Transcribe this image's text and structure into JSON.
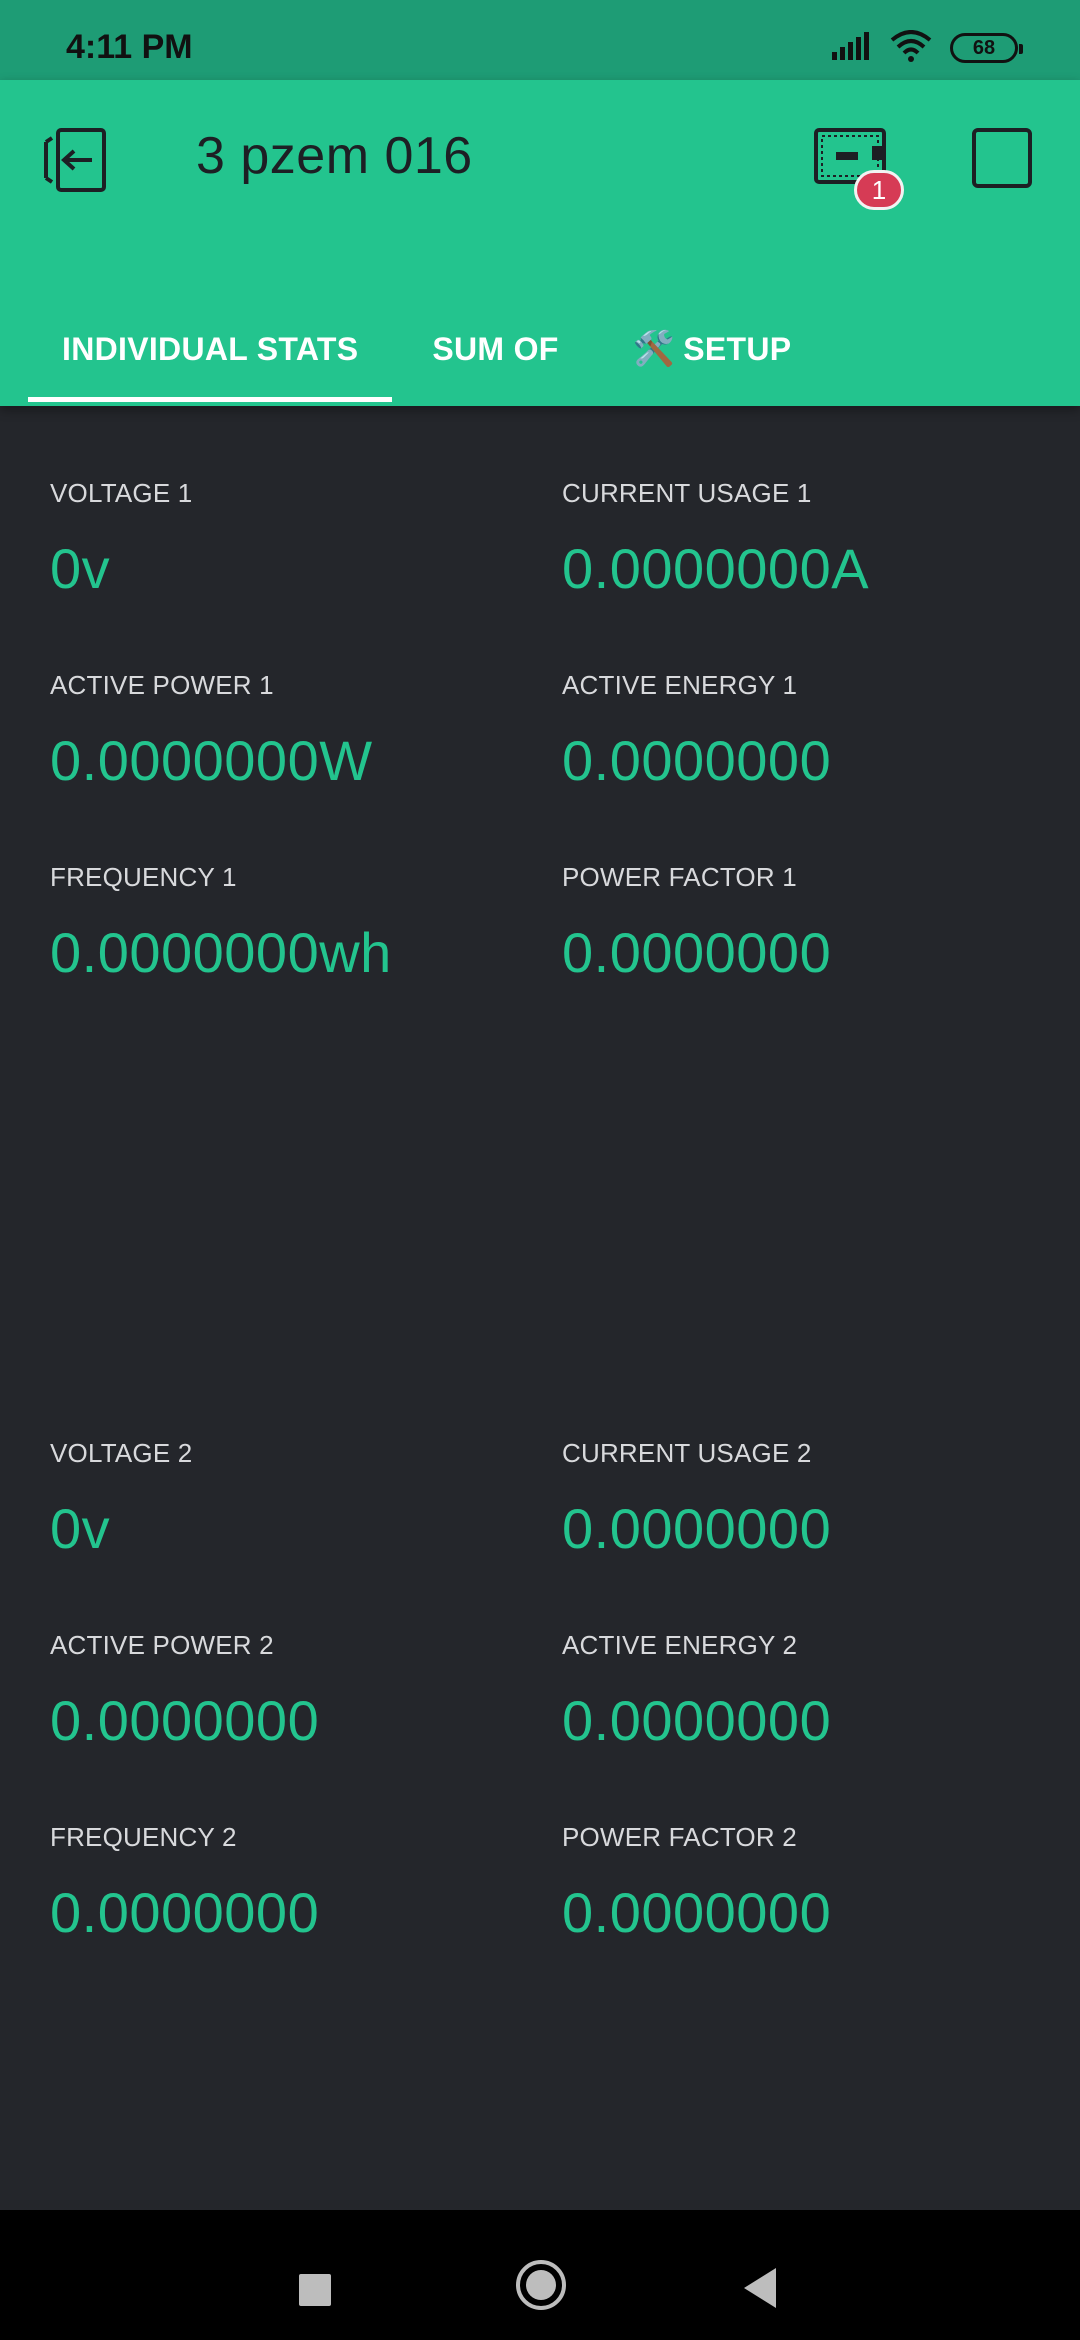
{
  "status_bar": {
    "time": "4:11 PM",
    "battery": "68",
    "icons": [
      "signal-icon",
      "wifi-icon",
      "battery-icon"
    ]
  },
  "header": {
    "title": "3 pzem 016",
    "device_badge": "1",
    "icons": [
      "exit-project-icon",
      "device-icon",
      "stop-icon"
    ],
    "colors": {
      "accent": "#23c48e",
      "badge": "#d63b55",
      "background": "#24262b"
    }
  },
  "tabs": [
    {
      "label": "INDIVIDUAL STATS",
      "active": true
    },
    {
      "label": "SUM OF",
      "active": false
    },
    {
      "label": "SETUP",
      "icon": "🛠️",
      "active": false
    }
  ],
  "widgets": [
    {
      "label": "VOLTAGE 1",
      "value": "0v"
    },
    {
      "label": "CURRENT USAGE 1",
      "value": "0.0000000A"
    },
    {
      "label": "ACTIVE POWER 1",
      "value": "0.0000000W"
    },
    {
      "label": "ACTIVE ENERGY 1",
      "value": "0.0000000"
    },
    {
      "label": "FREQUENCY 1",
      "value": "0.0000000wh"
    },
    {
      "label": "POWER FACTOR 1",
      "value": "0.0000000"
    },
    {
      "label": "VOLTAGE 2",
      "value": "0v"
    },
    {
      "label": "CURRENT USAGE 2",
      "value": "0.0000000"
    },
    {
      "label": "ACTIVE POWER 2",
      "value": "0.0000000"
    },
    {
      "label": "ACTIVE ENERGY 2",
      "value": "0.0000000"
    },
    {
      "label": "FREQUENCY 2",
      "value": "0.0000000"
    },
    {
      "label": "POWER FACTOR 2",
      "value": "0.0000000"
    }
  ],
  "nav_bar": {
    "icons": [
      "recents-icon",
      "home-icon",
      "back-icon"
    ]
  }
}
